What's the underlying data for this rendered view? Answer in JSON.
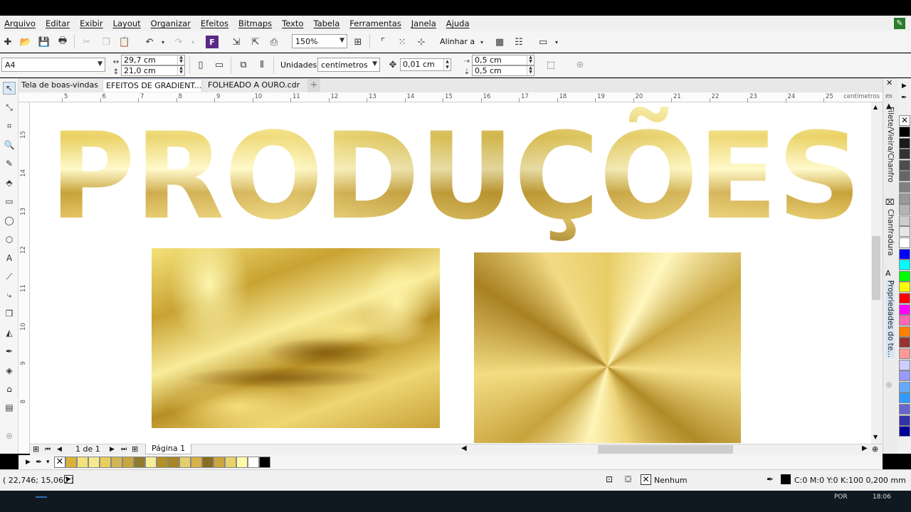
{
  "menu": [
    "Arquivo",
    "Editar",
    "Exibir",
    "Layout",
    "Organizar",
    "Efeitos",
    "Bitmaps",
    "Texto",
    "Tabela",
    "Ferramentas",
    "Janela",
    "Ajuda"
  ],
  "toolbar": {
    "zoom": "150%",
    "align_label": "Alinhar a"
  },
  "property_bar": {
    "page_size": "A4",
    "width": "29,7 cm",
    "height": "21,0 cm",
    "units_label": "Unidades:",
    "units": "centímetros",
    "nudge": "0,01 cm",
    "dup_x": "0,5 cm",
    "dup_y": "0,5 cm"
  },
  "tabs": [
    {
      "label": "Tela de boas-vindas",
      "active": false
    },
    {
      "label": "EFEITOS DE GRADIENT...",
      "active": true
    },
    {
      "label": "FOLHEADO A OURO.cdr",
      "active": false
    }
  ],
  "ruler": {
    "h_ticks": [
      "5",
      "6",
      "7",
      "8",
      "9",
      "10",
      "11",
      "12",
      "13",
      "14",
      "15",
      "16",
      "17",
      "18",
      "19",
      "20",
      "21",
      "22",
      "23",
      "24",
      "25"
    ],
    "unit": "centímetros",
    "v_ticks": [
      "15",
      "14",
      "13",
      "12",
      "11",
      "10",
      "9",
      "8"
    ]
  },
  "canvas": {
    "headline": "PRODUÇÕES"
  },
  "navigation": {
    "page_count": "1 de 1",
    "page_tab": "Página 1"
  },
  "doc_palette": [
    "#d9b13a",
    "#f3e27c",
    "#f6ea8f",
    "#e7cf5d",
    "#d2b555",
    "#c9a73c",
    "#8f7a2f",
    "#f6ef9a",
    "#b48f26",
    "#a88627",
    "#e3cf6c",
    "#d7b24a",
    "#8b6c1d",
    "#caa640",
    "#e8d26a",
    "#fffca8",
    "#ffffff",
    "#000000"
  ],
  "dockers": [
    "Filete/Vieira/Chanfro",
    "Chanfradura",
    "Propriedades do te..."
  ],
  "color_palette": [
    "#000000",
    "#1a1a1a",
    "#333333",
    "#4d4d4d",
    "#666666",
    "#808080",
    "#999999",
    "#b3b3b3",
    "#cccccc",
    "#e6e6e6",
    "#ffffff",
    "#0000ff",
    "#00ffff",
    "#00ff00",
    "#ffff00",
    "#ff0000",
    "#ff00ff",
    "#ff69b4",
    "#ff7f00",
    "#993333",
    "#ff9999",
    "#ccccff",
    "#9999ff",
    "#66aaff",
    "#3399ff",
    "#6666cc",
    "#3333aa",
    "#000099"
  ],
  "status": {
    "coords": "( 22,746; 15,060 )",
    "fill": "Nenhum",
    "outline": "C:0 M:0 Y:0 K:100  0,200 mm"
  },
  "taskbar": {
    "lang": "POR",
    "time": "18:06"
  },
  "colors": {
    "gold_light": "#fff3a6",
    "gold_mid": "#d8b445",
    "gold_dark": "#a07a1c"
  }
}
